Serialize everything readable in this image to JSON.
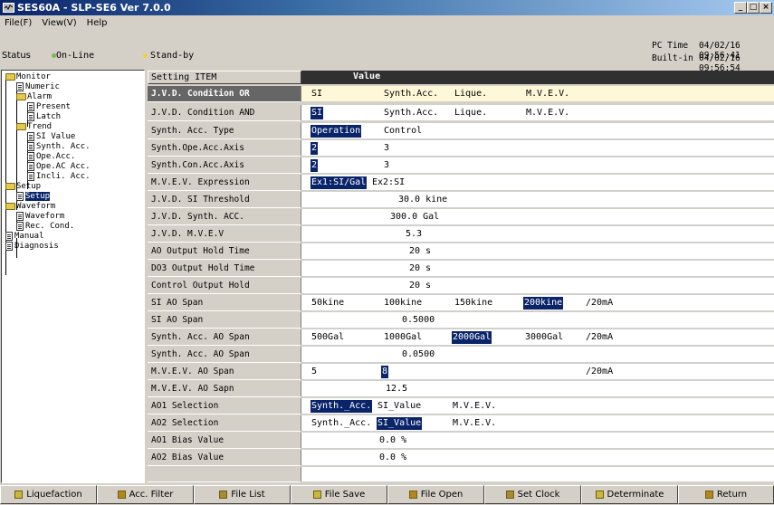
{
  "window": {
    "title": "SES60A - SLP-SE6 Ver 7.0.0",
    "controls": [
      "_",
      "□",
      "×"
    ]
  },
  "menu": [
    "File(F)",
    "View(V)",
    "Help"
  ],
  "status": {
    "label": "Status",
    "online": "On-Line",
    "standby": "Stand-by",
    "online_color": "#7ab84a",
    "standby_color": "#f0d040",
    "pc_time_label": "PC Time",
    "pc_time_value": "04/02/16 09:56:41",
    "builtin_label": "Built-in",
    "builtin_value": "04/02/16 09:56:54"
  },
  "tree": {
    "monitor": "Monitor",
    "numeric": "Numeric",
    "alarm": "Alarm",
    "present": "Present",
    "latch": "Latch",
    "trend": "Trend",
    "si_value": "SI Value",
    "synth_acc": "Synth. Acc.",
    "ope_acc": "Ope.Acc.",
    "ope_ac_acc": "Ope.AC Acc.",
    "incli_acc": "Incli. Acc.",
    "setup": "Setup",
    "setup_child": "Setup",
    "waveform": "Waveform",
    "waveform_child": "Waveform",
    "rec_cond": "Rec. Cond.",
    "manual": "Manual",
    "diagnosis": "Diagnosis"
  },
  "grid": {
    "header_item": "Setting ITEM",
    "header_value": "Value",
    "rows": [
      {
        "item": "J.V.D. Condition OR",
        "cells": [
          "SI",
          "Synth.Acc.",
          "Lique.",
          "M.V.E.V."
        ]
      },
      {
        "item": "J.V.D. Condition AND",
        "cells": [
          "SI",
          "Synth.Acc.",
          "Lique.",
          "M.V.E.V."
        ]
      },
      {
        "item": "Synth. Acc. Type",
        "cells": [
          "Operation",
          "Control"
        ]
      },
      {
        "item": "Synth.Ope.Acc.Axis",
        "cells": [
          "2",
          "3"
        ]
      },
      {
        "item": "Synth.Con.Acc.Axis",
        "cells": [
          "2",
          "3"
        ]
      },
      {
        "item": "M.V.E.V. Expression",
        "cells": [
          "Ex1:SI/Gal",
          "Ex2:SI"
        ]
      },
      {
        "item": "J.V.D. SI Threshold",
        "cells": [
          "30.0 kine"
        ]
      },
      {
        "item": "J.V.D. Synth. ACC.",
        "cells": [
          "300.0 Gal"
        ]
      },
      {
        "item": "J.V.D. M.V.E.V",
        "cells": [
          "5.3"
        ]
      },
      {
        "item": "AO Output Hold Time",
        "cells": [
          "20 s"
        ]
      },
      {
        "item": "DO3 Output Hold Time",
        "cells": [
          "20 s"
        ]
      },
      {
        "item": "Control Output Hold",
        "cells": [
          "20 s"
        ]
      },
      {
        "item": "SI AO Span",
        "cells": [
          "50kine",
          "100kine",
          "150kine",
          "200kine",
          "/20mA"
        ]
      },
      {
        "item": "SI AO Span",
        "cells": [
          "0.5000"
        ]
      },
      {
        "item": "Synth. Acc. AO Span",
        "cells": [
          "500Gal",
          "1000Gal",
          "2000Gal",
          "3000Gal",
          "/20mA"
        ]
      },
      {
        "item": "Synth. Acc. AO Span",
        "cells": [
          "0.0500"
        ]
      },
      {
        "item": "M.V.E.V. AO Span",
        "cells": [
          "5",
          "8",
          "/20mA"
        ]
      },
      {
        "item": "M.V.E.V. AO Sapn",
        "cells": [
          "12.5"
        ]
      },
      {
        "item": "AO1 Selection",
        "cells": [
          "Synth._Acc.",
          "SI_Value",
          "M.V.E.V."
        ]
      },
      {
        "item": "AO2 Selection",
        "cells": [
          "Synth._Acc.",
          "SI_Value",
          "M.V.E.V."
        ]
      },
      {
        "item": "AO1 Bias Value",
        "cells": [
          "0.0 %"
        ]
      },
      {
        "item": "AO2 Bias Value",
        "cells": [
          "0.0 %"
        ]
      }
    ]
  },
  "fkeys": [
    {
      "key": "F1",
      "label": "Liquefaction"
    },
    {
      "key": "F2",
      "label": "Acc. Filter"
    },
    {
      "key": "F3",
      "label": "File List"
    },
    {
      "key": "F4",
      "label": "File Save"
    },
    {
      "key": "F5",
      "label": "File Open"
    },
    {
      "key": "F6",
      "label": "Set Clock"
    },
    {
      "key": "F7",
      "label": "Determinate"
    },
    {
      "key": "F8",
      "label": "Return"
    }
  ]
}
